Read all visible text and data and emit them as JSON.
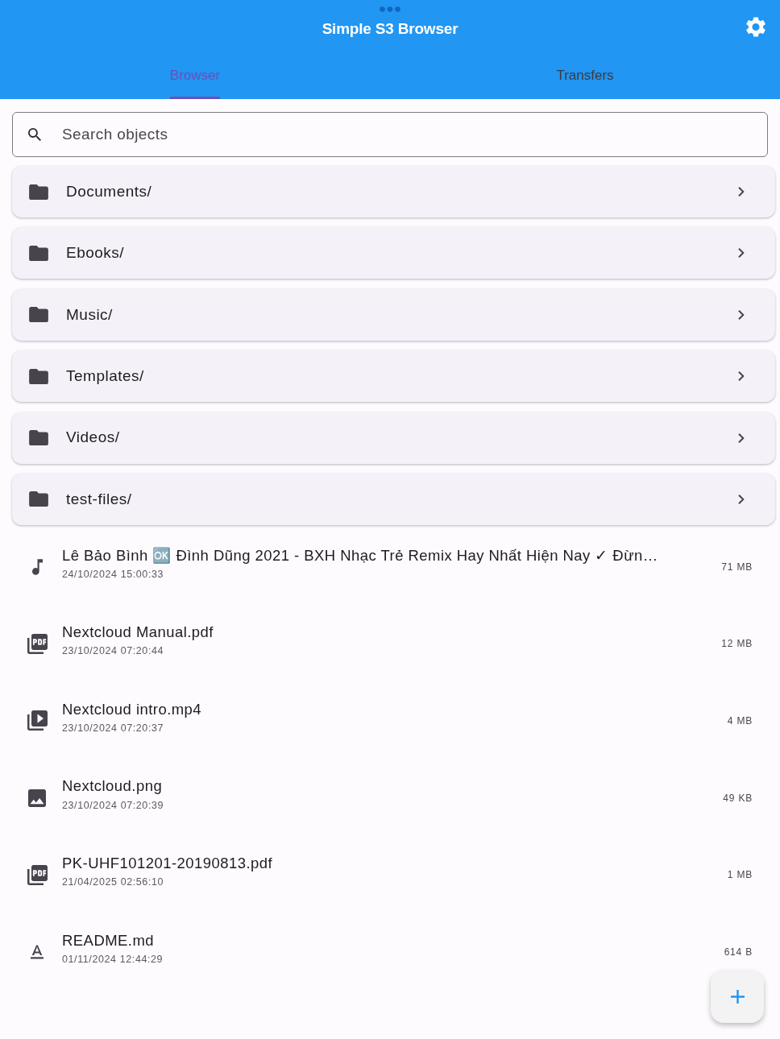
{
  "app_bar": {
    "title": "Simple S3 Browser"
  },
  "tabs": [
    {
      "label": "Browser",
      "selected": true
    },
    {
      "label": "Transfers",
      "selected": false
    }
  ],
  "search": {
    "placeholder": "Search objects"
  },
  "folders": [
    {
      "name": "Documents/"
    },
    {
      "name": "Ebooks/"
    },
    {
      "name": "Music/"
    },
    {
      "name": "Templates/"
    },
    {
      "name": "Videos/"
    },
    {
      "name": "test-files/"
    }
  ],
  "files": [
    {
      "kind": "audio",
      "name": "Lê Bảo Bình 🆗 Đình Dũng 2021 - BXH Nhạc Trẻ Remix Hay Nhất Hiện Nay ✓ Đừn…",
      "date": "24/10/2024 15:00:33",
      "size": "71 MB"
    },
    {
      "kind": "pdf",
      "name": "Nextcloud Manual.pdf",
      "date": "23/10/2024 07:20:44",
      "size": "12 MB"
    },
    {
      "kind": "video",
      "name": "Nextcloud intro.mp4",
      "date": "23/10/2024 07:20:37",
      "size": "4 MB"
    },
    {
      "kind": "image",
      "name": "Nextcloud.png",
      "date": "23/10/2024 07:20:39",
      "size": "49 KB"
    },
    {
      "kind": "pdf",
      "name": "PK-UHF101201-20190813.pdf",
      "date": "21/04/2025 02:56:10",
      "size": "1 MB"
    },
    {
      "kind": "text",
      "name": "README.md",
      "date": "01/11/2024 12:44:29",
      "size": "614 B"
    }
  ]
}
